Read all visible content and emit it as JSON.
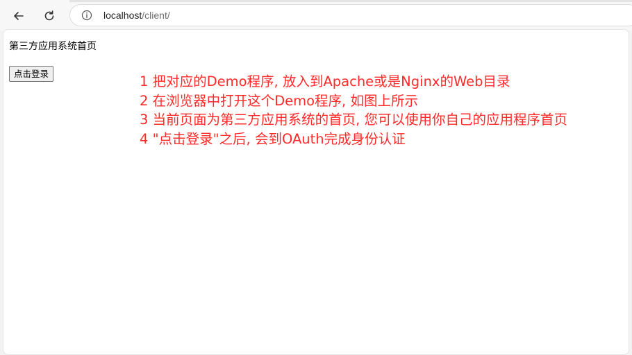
{
  "browser": {
    "url_host": "localhost",
    "url_path": "/client/",
    "icons": {
      "back": "back-arrow-icon",
      "reload": "reload-icon",
      "site_info": "info-icon"
    }
  },
  "page": {
    "title": "第三方应用系统首页",
    "login_button_label": "点击登录",
    "instructions": [
      "1 把对应的Demo程序, 放入到Apache或是Nginx的Web目录",
      "2 在浏览器中打开这个Demo程序, 如图上所示",
      "3 当前页面为第三方应用系统的首页, 您可以使用你自己的应用程序首页",
      "4 \"点击登录\"之后, 会到OAuth完成身份认证"
    ],
    "instruction_color": "#ff2a2a"
  }
}
